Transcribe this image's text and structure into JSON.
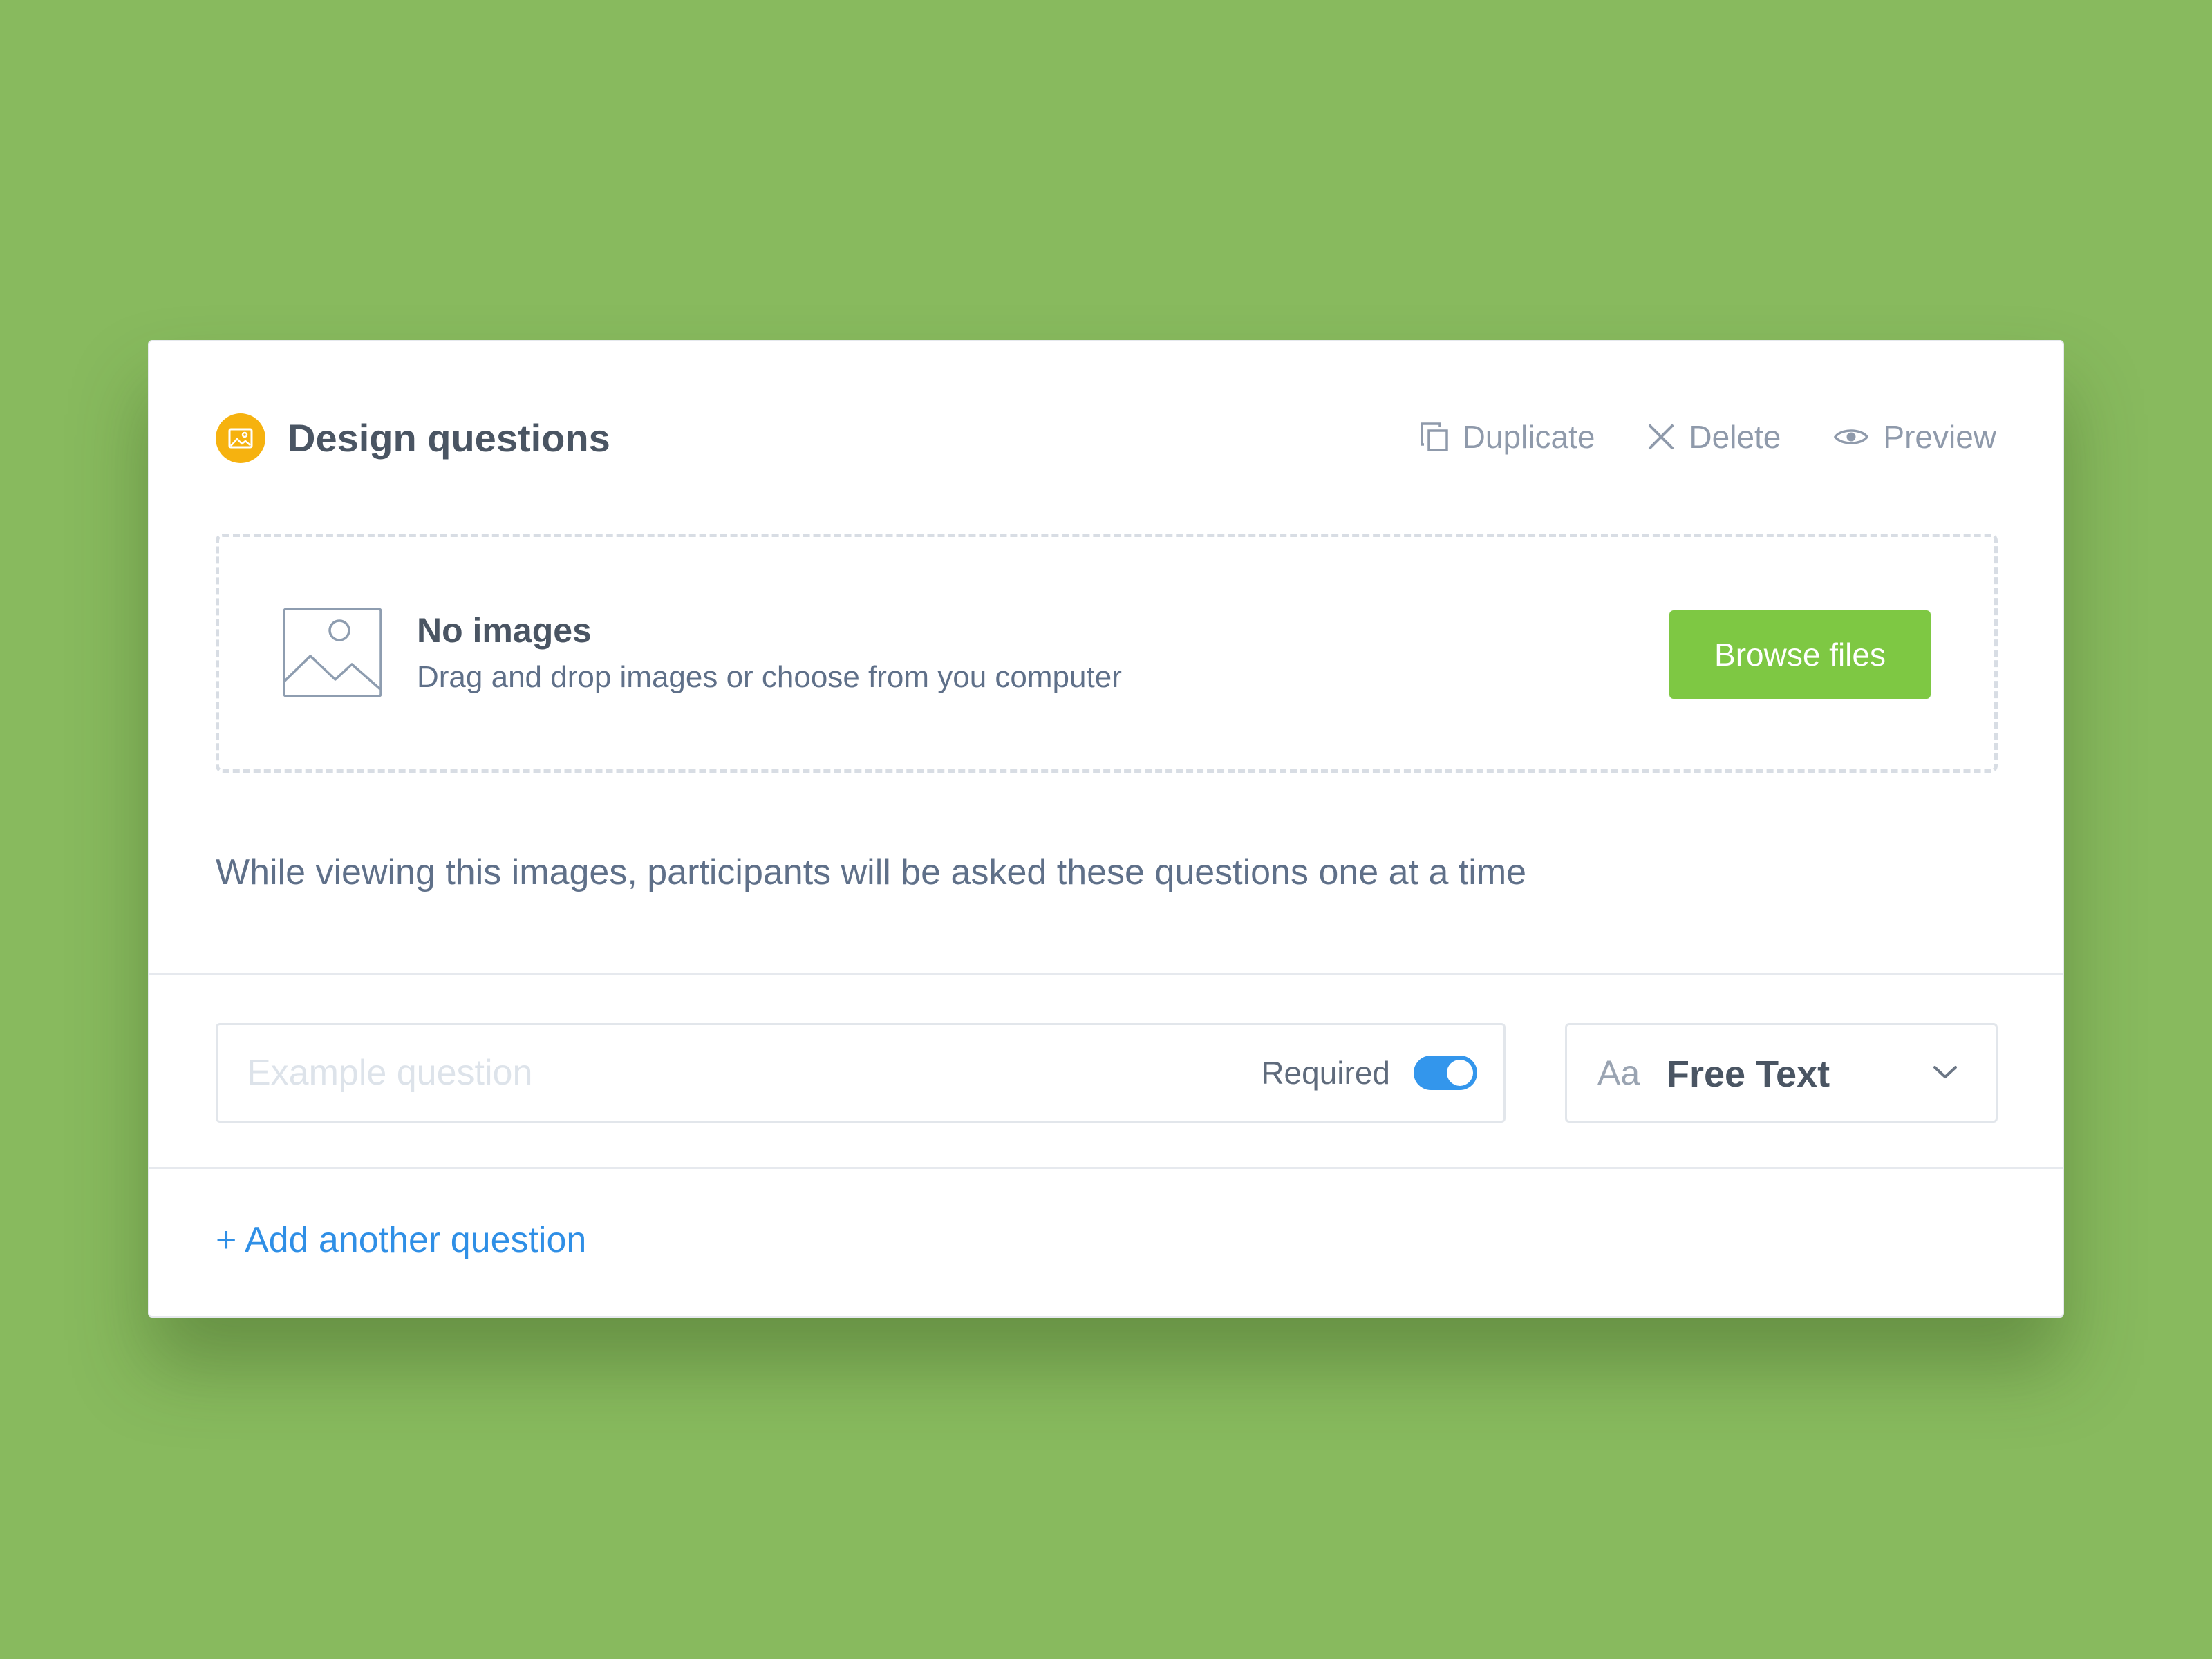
{
  "colors": {
    "background": "#88ba5e",
    "accent_orange": "#f6b20f",
    "browse_button": "#7ec843",
    "toggle_on": "#3396ec",
    "link": "#2f8fe6"
  },
  "header": {
    "icon": "image-icon",
    "title": "Design questions",
    "actions": [
      {
        "label": "Duplicate",
        "icon": "duplicate-icon"
      },
      {
        "label": "Delete",
        "icon": "close-icon"
      },
      {
        "label": "Preview",
        "icon": "eye-icon"
      }
    ]
  },
  "dropzone": {
    "icon": "image-placeholder-icon",
    "title": "No images",
    "subtitle": "Drag and drop images or choose from you computer",
    "button_label": "Browse files"
  },
  "info_text": "While viewing this images, participants will be asked these questions one at a time",
  "question": {
    "placeholder": "Example question",
    "value": "",
    "required_label": "Required",
    "required": true
  },
  "type_select": {
    "icon_text": "Aa",
    "value": "Free Text",
    "icon": "chevron-down-icon"
  },
  "add_question_label": "+ Add another question"
}
